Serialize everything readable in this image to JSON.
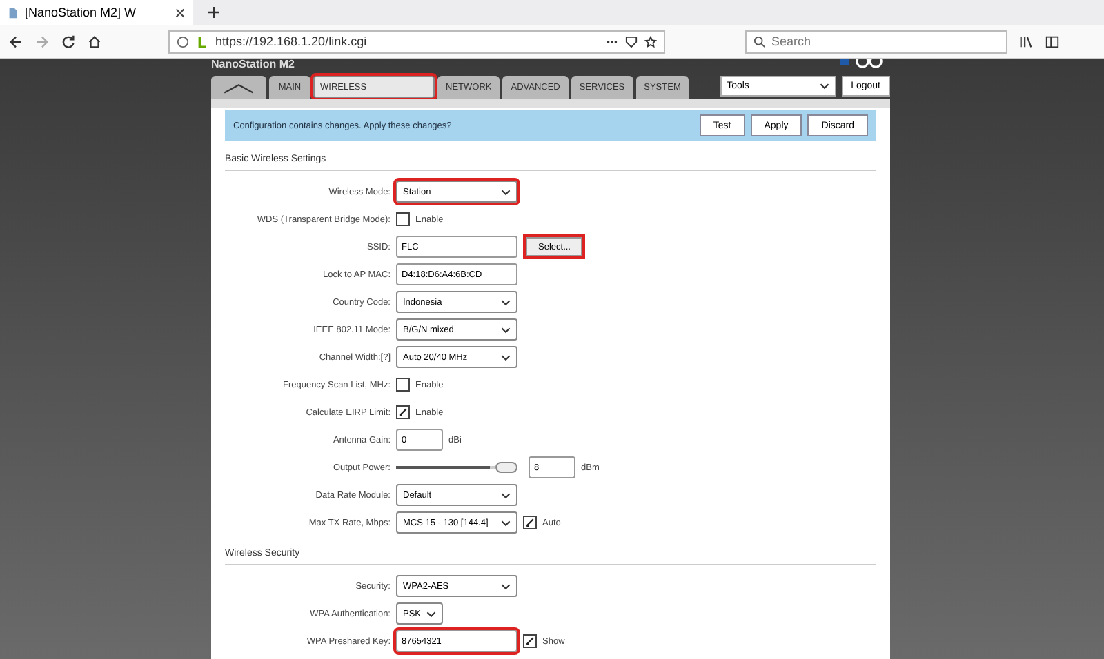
{
  "browser": {
    "tab_title": "[NanoStation M2] W",
    "url": "https://192.168.1.20/link.cgi",
    "search": {
      "placeholder": "Search"
    }
  },
  "header": {
    "product": "NanoStation M2"
  },
  "tabs": [
    {
      "kind": "logo",
      "selected": false,
      "highlighted": false
    },
    {
      "label": "MAIN",
      "kind": "text",
      "selected": false,
      "highlighted": false
    },
    {
      "label": "WIRELESS",
      "kind": "text",
      "selected": true,
      "highlighted": true
    },
    {
      "label": "NETWORK",
      "kind": "text",
      "selected": false,
      "highlighted": false
    },
    {
      "label": "ADVANCED",
      "kind": "text",
      "selected": false,
      "highlighted": false
    },
    {
      "label": "SERVICES",
      "kind": "text",
      "selected": false,
      "highlighted": false
    },
    {
      "label": "SYSTEM",
      "kind": "text",
      "selected": false,
      "highlighted": false
    }
  ],
  "tools": {
    "value": "Tools",
    "logout": "Logout"
  },
  "alert": {
    "message": "Configuration contains changes. Apply these changes?",
    "buttons": [
      "Test",
      "Apply",
      "Discard"
    ]
  },
  "sections": [
    {
      "title": "Basic Wireless Settings",
      "rows": [
        {
          "kind": "select",
          "label": "Wireless Mode:",
          "value": "Station",
          "highlighted": true
        },
        {
          "kind": "checkbox",
          "label": "WDS (Transparent Bridge Mode):",
          "checked": false,
          "text": "Enable"
        },
        {
          "kind": "text",
          "label": "SSID:",
          "value": "FLC",
          "button": {
            "label": "Select...",
            "highlighted": true
          }
        },
        {
          "kind": "text",
          "label": "Lock to AP MAC:",
          "value": "D4:18:D6:A4:6B:CD"
        },
        {
          "kind": "select",
          "label": "Country Code:",
          "value": "Indonesia"
        },
        {
          "kind": "select",
          "label": "IEEE 802.11 Mode:",
          "value": "B/G/N mixed"
        },
        {
          "kind": "select",
          "label": "Channel Width:[?]",
          "value": "Auto 20/40 MHz"
        },
        {
          "kind": "checkbox",
          "label": "Frequency Scan List, MHz:",
          "checked": false,
          "text": "Enable"
        },
        {
          "kind": "checkbox",
          "label": "Calculate EIRP Limit:",
          "checked": true,
          "text": "Enable"
        },
        {
          "kind": "number",
          "label": "Antenna Gain:",
          "value": "0",
          "unit": "dBi"
        },
        {
          "kind": "slider",
          "label": "Output Power:",
          "level": 0.95,
          "value": "8",
          "unit": "dBm"
        },
        {
          "kind": "select",
          "label": "Data Rate Module:",
          "value": "Default"
        },
        {
          "kind": "select",
          "label": "Max TX Rate, Mbps:",
          "value": "MCS 15 - 130 [144.4]",
          "check": {
            "text": "Auto",
            "checked": true
          }
        }
      ]
    },
    {
      "title": "Wireless Security",
      "rows": [
        {
          "kind": "select",
          "label": "Security:",
          "value": "WPA2-AES"
        },
        {
          "kind": "short_select",
          "label": "WPA Authentication:",
          "value": "PSK"
        },
        {
          "kind": "text",
          "label": "WPA Preshared Key:",
          "value": "87654321",
          "highlighted": true,
          "check": {
            "text": "Show",
            "checked": true
          }
        }
      ]
    }
  ]
}
